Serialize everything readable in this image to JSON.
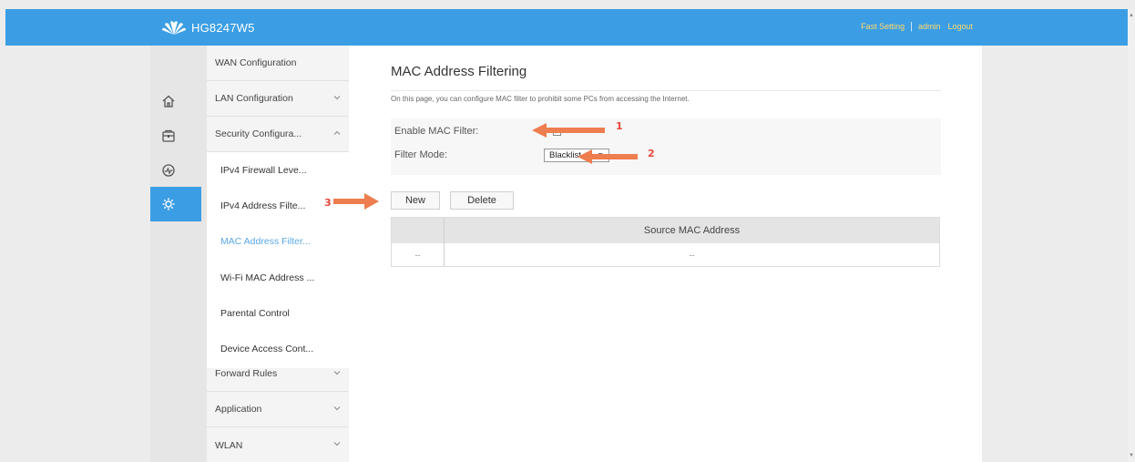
{
  "header": {
    "brand": "HG8247W5",
    "links": [
      "Fast Setting",
      "admin",
      "Logout"
    ],
    "separator": "|"
  },
  "icons": [
    "home-icon",
    "security-box-icon",
    "diagnose-icon",
    "settings-icon"
  ],
  "menu": {
    "wan": "WAN Configuration",
    "lan": "LAN Configuration",
    "security": "Security Configura...",
    "forward": "Forward Rules",
    "application": "Application",
    "wlan": "WLAN"
  },
  "submenu": [
    "IPv4 Firewall Leve...",
    "IPv4 Address Filte...",
    "MAC Address Filter...",
    "Wi-Fi MAC Address ...",
    "Parental Control",
    "Device Access Cont..."
  ],
  "main": {
    "title": "MAC Address Filtering",
    "description": "On this page, you can configure MAC filter to prohibit some PCs from accessing the Internet.",
    "enable_label": "Enable MAC Filter:",
    "enable_checked": true,
    "mode_label": "Filter Mode:",
    "mode_value": "Blacklist",
    "new_button": "New",
    "delete_button": "Delete",
    "table_header": "Source MAC Address",
    "table_row": [
      "--",
      "--"
    ]
  },
  "annotations": [
    "1",
    "2",
    "3"
  ],
  "colors": {
    "topbar": "#3b9ee4",
    "link": "#ffd96b",
    "selected": "#5aa8e8",
    "arrow": "#ee7d4f"
  }
}
